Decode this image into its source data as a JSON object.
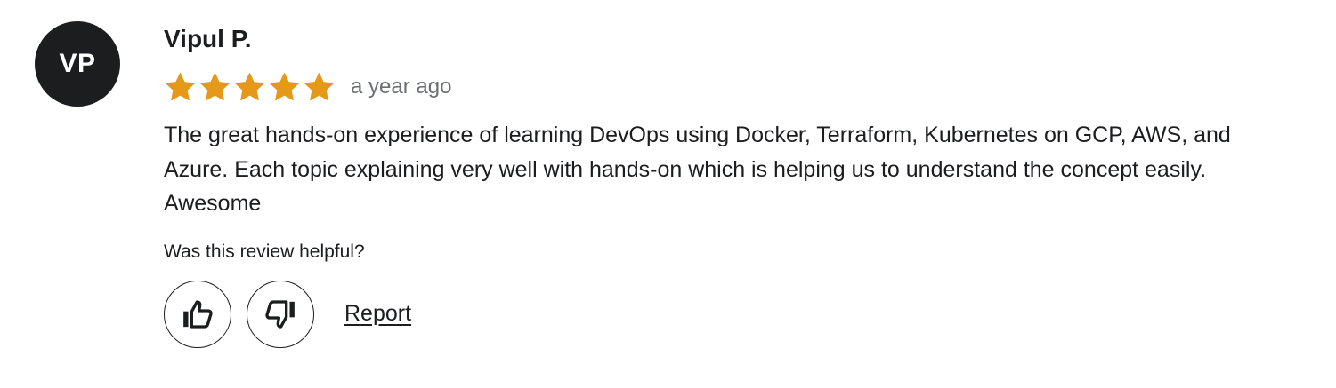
{
  "review": {
    "avatar_initials": "VP",
    "reviewer_name": "Vipul P.",
    "rating": 5,
    "rating_max": 5,
    "star_color": "#e59819",
    "time_ago": "a year ago",
    "text": "The great hands-on experience of learning DevOps using Docker, Terraform, Kubernetes on GCP, AWS, and Azure. Each topic explaining very well with hands-on which is helping us to understand the concept easily. Awesome",
    "helpful_question": "Was this review helpful?",
    "thumbs_up_icon": "thumbs-up-icon",
    "thumbs_down_icon": "thumbs-down-icon",
    "report_label": "Report"
  }
}
